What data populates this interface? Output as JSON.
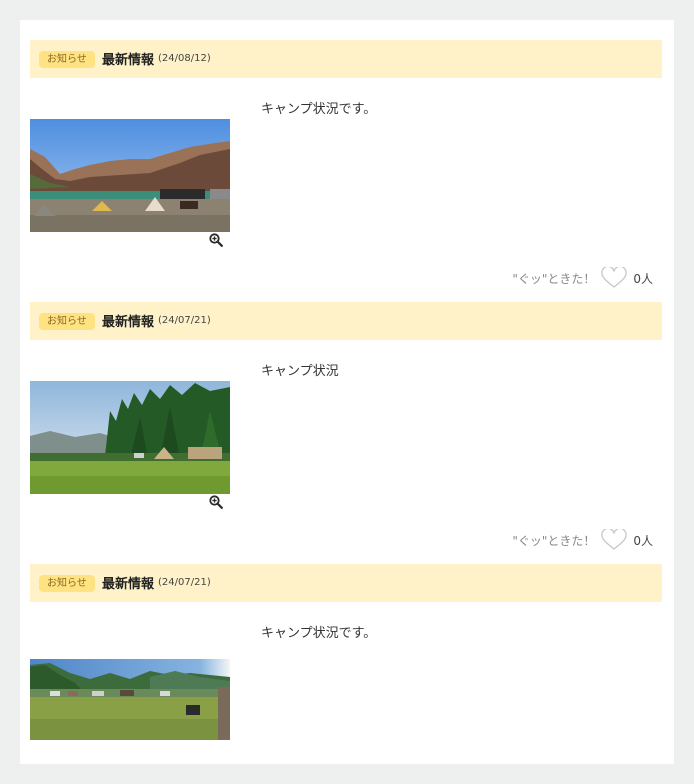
{
  "posts": [
    {
      "badge": "お知らせ",
      "title": "最新情報",
      "date": "(24/08/12)",
      "text": "キャンプ状況です。",
      "like_label": "\"ぐッ\"ときた！",
      "like_count": "0人"
    },
    {
      "badge": "お知らせ",
      "title": "最新情報",
      "date": "(24/07/21)",
      "text": "キャンプ状況",
      "like_label": "\"ぐッ\"ときた！",
      "like_count": "0人"
    },
    {
      "badge": "お知らせ",
      "title": "最新情報",
      "date": "(24/07/21)",
      "text": "キャンプ状況です。"
    }
  ]
}
